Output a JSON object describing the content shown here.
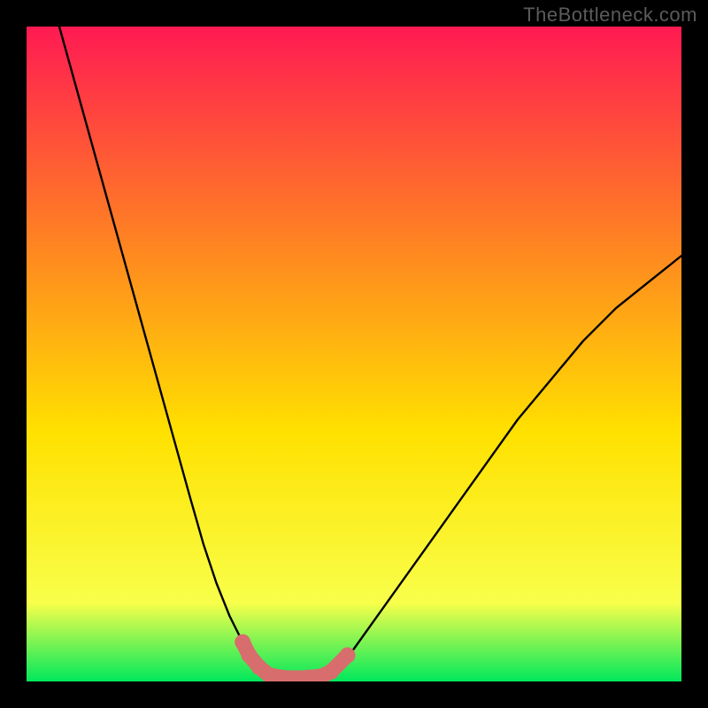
{
  "watermark": "TheBottleneck.com",
  "colors": {
    "frame": "#000000",
    "gradient_top": "#ff1a52",
    "gradient_mid1": "#ff8a1f",
    "gradient_mid2": "#ffe100",
    "gradient_mid3": "#f8ff4a",
    "gradient_bottom": "#00e85c",
    "curve": "#000000",
    "markers": "#d86d6d"
  },
  "chart_data": {
    "type": "line",
    "title": "",
    "xlabel": "",
    "ylabel": "",
    "xlim": [
      0,
      100
    ],
    "ylim": [
      0,
      100
    ],
    "note": "Values are estimated from pixel positions; the chart has no visible axis numbers.",
    "series": [
      {
        "name": "left-branch",
        "x": [
          5,
          10,
          15,
          20,
          25,
          27,
          29,
          31,
          33,
          34,
          35.5,
          37,
          40
        ],
        "y": [
          100,
          82,
          64,
          46,
          28,
          21,
          15,
          10,
          6,
          4,
          2.2,
          1.0,
          0.5
        ]
      },
      {
        "name": "valley-floor",
        "x": [
          37,
          40,
          43,
          46
        ],
        "y": [
          1.0,
          0.5,
          0.5,
          1.0
        ]
      },
      {
        "name": "right-branch",
        "x": [
          46,
          48,
          50,
          55,
          60,
          65,
          70,
          75,
          80,
          85,
          90,
          95,
          100
        ],
        "y": [
          1.0,
          2.5,
          5,
          12,
          19,
          26,
          33,
          40,
          46,
          52,
          57,
          61,
          65
        ]
      }
    ],
    "markers": [
      {
        "name": "left-cluster-dot-1",
        "x": 33.0,
        "y": 6.0
      },
      {
        "name": "left-cluster-dot-2",
        "x": 34.0,
        "y": 4.0
      },
      {
        "name": "left-cluster-dot-3",
        "x": 35.5,
        "y": 2.2
      },
      {
        "name": "left-cluster-dot-4",
        "x": 37.0,
        "y": 1.0
      },
      {
        "name": "floor-dot-1",
        "x": 39.0,
        "y": 0.6
      },
      {
        "name": "floor-dot-2",
        "x": 41.0,
        "y": 0.5
      },
      {
        "name": "floor-dot-3",
        "x": 43.0,
        "y": 0.6
      },
      {
        "name": "floor-dot-4",
        "x": 45.0,
        "y": 0.8
      },
      {
        "name": "right-cluster-dot-1",
        "x": 46.5,
        "y": 1.5
      },
      {
        "name": "right-cluster-dot-2",
        "x": 49.0,
        "y": 4.0
      }
    ]
  }
}
